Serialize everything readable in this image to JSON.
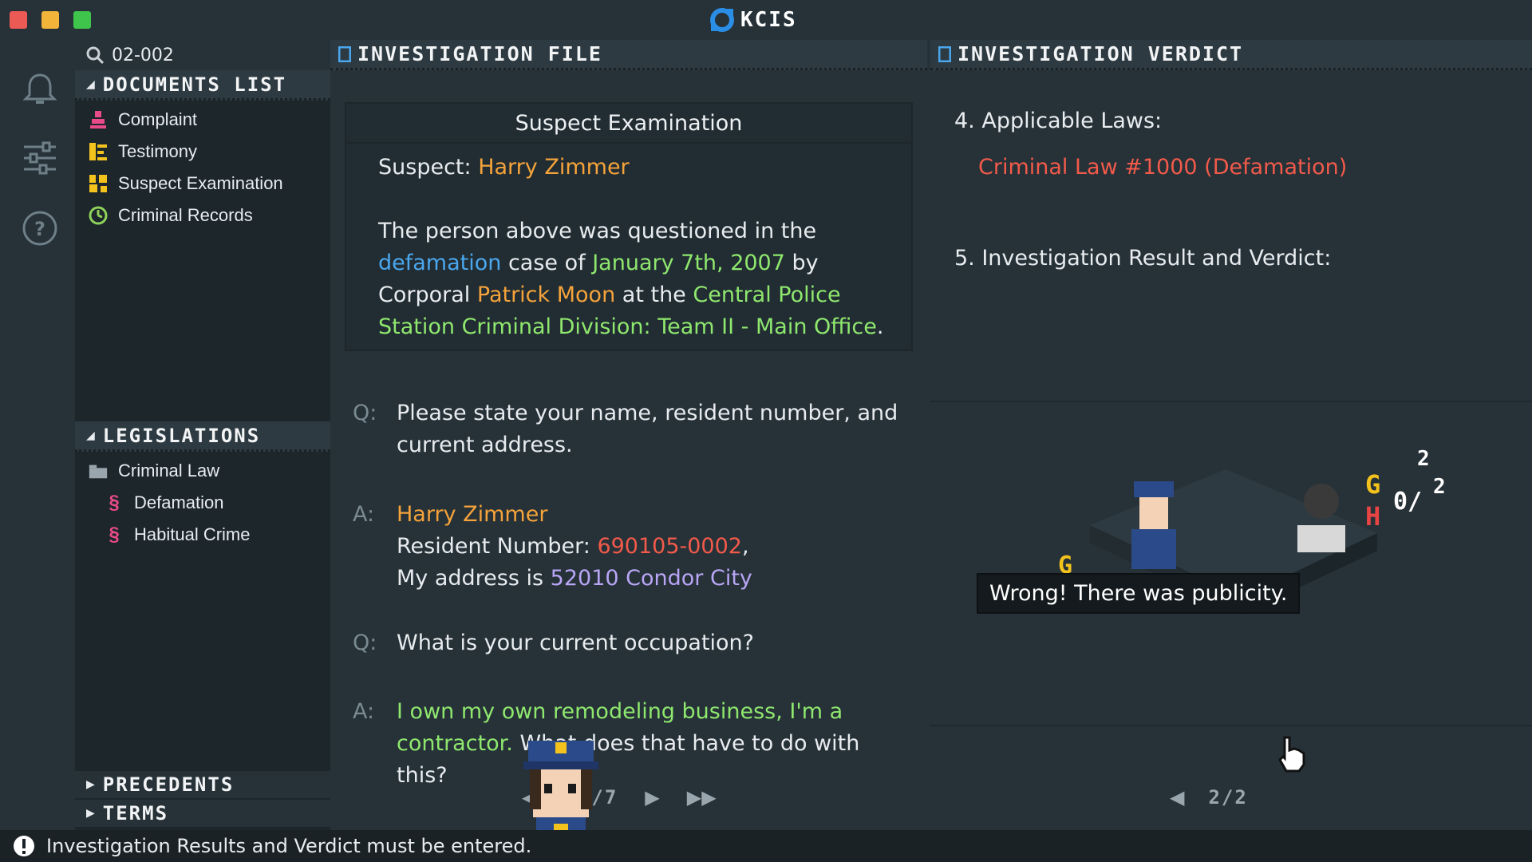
{
  "app": {
    "name": "KCIS"
  },
  "search": {
    "query": "02-002"
  },
  "documents": {
    "header": "Documents List",
    "items": [
      {
        "label": "Complaint",
        "icon": "complaint-icon",
        "color": "#e84a8a"
      },
      {
        "label": "Testimony",
        "icon": "testimony-icon",
        "color": "#f4c21c"
      },
      {
        "label": "Suspect Examination",
        "icon": "suspect-examination-icon",
        "color": "#f4c21c"
      },
      {
        "label": "Criminal Records",
        "icon": "criminal-records-icon",
        "color": "#8fd25a"
      }
    ]
  },
  "legislations": {
    "header": "Legislations",
    "folder": "Criminal Law",
    "laws": [
      "Defamation",
      "Habitual Crime"
    ]
  },
  "precedents": {
    "header": "Precedents"
  },
  "terms": {
    "header": "Terms"
  },
  "investigation_file": {
    "header": "Investigation File",
    "exam_title": "Suspect Examination",
    "suspect_label": "Suspect:",
    "suspect_name": "Harry Zimmer",
    "para": {
      "p1": "The person above was questioned in the",
      "crime": "defamation",
      "p2": " case of ",
      "date": "January 7th, 2007",
      "p3": " by",
      "p4": "Corporal ",
      "officer": "Patrick Moon",
      "p5": " at the ",
      "station": "Central Police Station Criminal Division: Team II - Main Office",
      "p6": "."
    },
    "qa": [
      {
        "tag": "Q:",
        "text": "Please state your name, resident number, and current address."
      },
      {
        "tag": "A:",
        "name": "Harry Zimmer",
        "resident_label": "Resident Number: ",
        "resident_number": "690105-0002",
        "resident_suffix": ",",
        "address_label": "My address is ",
        "address": "52010 Condor City"
      },
      {
        "tag": "Q:",
        "text": "What is your current occupation?"
      },
      {
        "tag": "A:",
        "highlight": "I own my own remodeling business, I'm a contractor.",
        "rest": " What does that have to do with this?"
      }
    ],
    "pager": {
      "current": "4/7"
    }
  },
  "verdict": {
    "header": "Investigation Verdict",
    "laws_heading": "4. Applicable Laws:",
    "law": "Criminal Law #1000 (Defamation)",
    "result_heading": "5. Investigation Result and Verdict:",
    "speech": "Wrong! There was publicity.",
    "pager": {
      "current": "2/2"
    }
  },
  "status": {
    "message": "Investigation Results and Verdict must be entered."
  }
}
